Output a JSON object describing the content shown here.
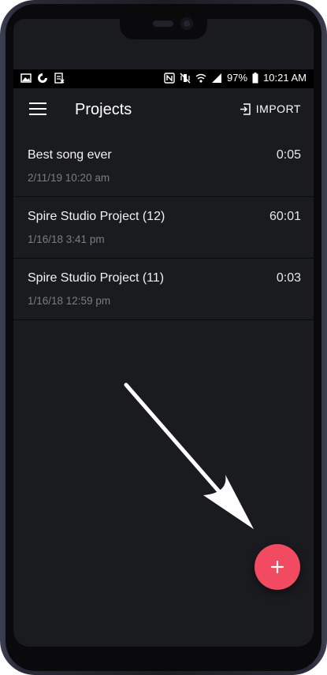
{
  "status_bar": {
    "battery_percent": "97%",
    "time": "10:21 AM"
  },
  "app_bar": {
    "title": "Projects",
    "import_label": "IMPORT"
  },
  "projects": [
    {
      "title": "Best song ever",
      "date": "2/11/19 10:20 am",
      "duration": "0:05"
    },
    {
      "title": "Spire Studio Project (12)",
      "date": "1/16/18 3:41 pm",
      "duration": "60:01"
    },
    {
      "title": "Spire Studio Project (11)",
      "date": "1/16/18 12:59 pm",
      "duration": "0:03"
    }
  ],
  "fab": {
    "icon": "plus-icon",
    "color": "#f14a61"
  },
  "colors": {
    "background": "#1a1b1f",
    "text_primary": "#f2f2f2",
    "text_secondary": "#7c7d82",
    "accent": "#f14a61"
  },
  "annotation": {
    "icon": "arrow-pointer-icon",
    "color": "#ffffff"
  }
}
